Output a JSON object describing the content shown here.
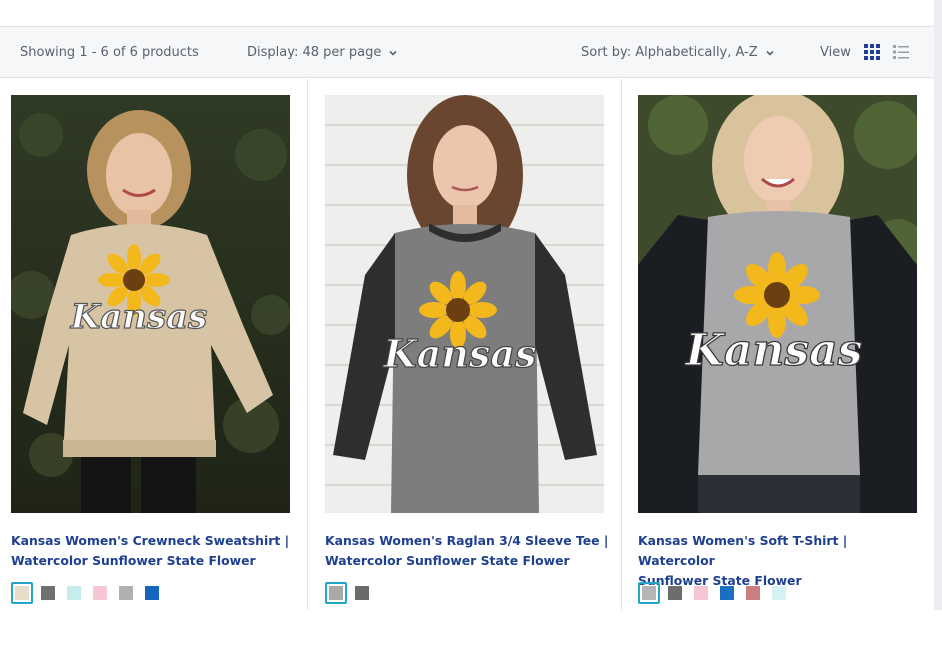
{
  "toolbar": {
    "results_text": "Showing 1 - 6 of 6 products",
    "display_label": "Display: 48 per page",
    "sort_label": "Sort by: Alphabetically, A-Z",
    "view_label": "View"
  },
  "products": [
    {
      "title_line1": "Kansas Women's Crewneck Sweatshirt |",
      "title_line2": "Watercolor Sunflower State Flower",
      "image_text": "Kansas",
      "swatches": [
        "#e8dccb",
        "#707070",
        "#c7ecec",
        "#f7c5d4",
        "#b0b0b0",
        "#1565c0"
      ],
      "active_swatch": 0
    },
    {
      "title_line1": "Kansas Women's Raglan 3/4 Sleeve Tee |",
      "title_line2": "Watercolor Sunflower State Flower",
      "image_text": "Kansas",
      "swatches": [
        "#a9a9a9",
        "#6a6a6a"
      ],
      "active_swatch": 0
    },
    {
      "title_line1": "Kansas Women's Soft T-Shirt | Watercolor",
      "title_line2": "Sunflower State Flower",
      "image_text": "Kansas",
      "swatches": [
        "#b5b5b5",
        "#6d6d6d",
        "#f6c6d5",
        "#1a6fc1",
        "#c97f7f",
        "#d6f2f4"
      ],
      "active_swatch": 0
    }
  ],
  "colors": {
    "accent": "#1f3f8f",
    "active_swatch_border": "#22a5c6"
  }
}
